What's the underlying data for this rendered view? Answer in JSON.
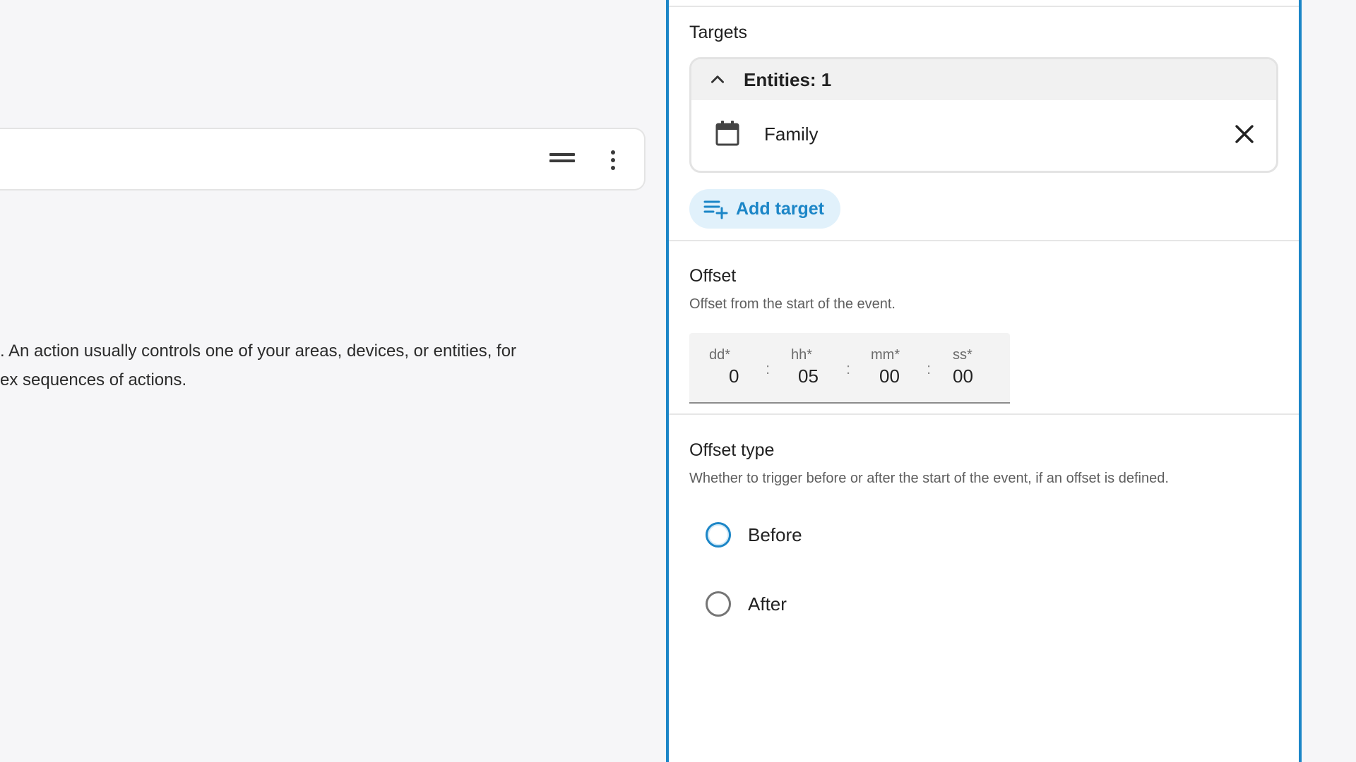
{
  "left": {
    "help_line_1": ". An action usually controls one of your areas, devices, or entities, for",
    "help_line_2": "ex sequences of actions."
  },
  "panel": {
    "targets": {
      "title": "Targets",
      "entities_header": "Entities: 1",
      "entity_name": "Family",
      "entity_icon": "calendar-icon",
      "add_target_label": "Add target"
    },
    "offset": {
      "title": "Offset",
      "description": "Offset from the start of the event.",
      "fields": [
        {
          "unit": "dd*",
          "value": "0"
        },
        {
          "unit": "hh*",
          "value": "05"
        },
        {
          "unit": "mm*",
          "value": "00"
        },
        {
          "unit": "ss*",
          "value": "00"
        }
      ],
      "separator": ":"
    },
    "offset_type": {
      "title": "Offset type",
      "description": "Whether to trigger before or after the start of the event, if an offset is defined.",
      "options": [
        {
          "label": "Before",
          "selected": false
        },
        {
          "label": "After",
          "selected": false
        }
      ]
    }
  },
  "colors": {
    "accent": "#1c86c7",
    "accent_light": "#e1f1fb",
    "background": "#f6f6f8"
  }
}
